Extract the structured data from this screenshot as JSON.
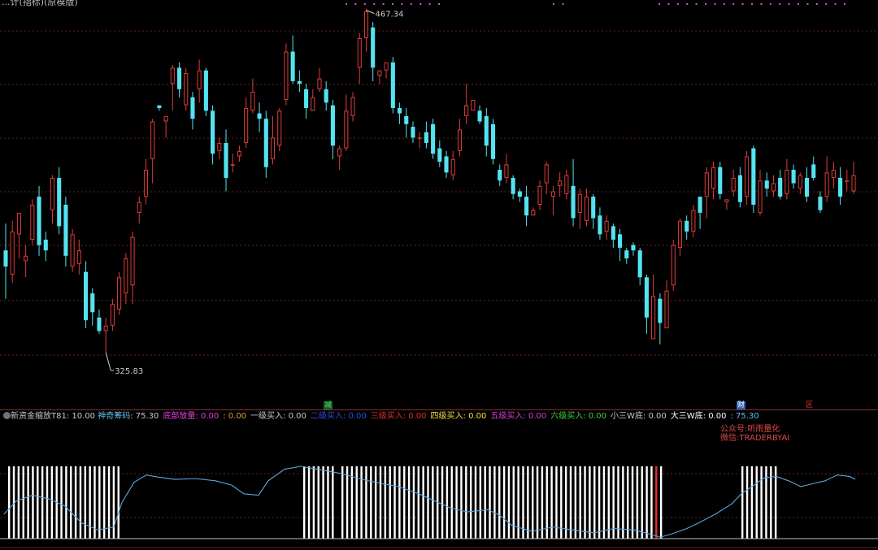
{
  "window": {
    "title": "...计(指标)(原模版)"
  },
  "theme": {
    "background": "#000000",
    "up_color": "#e03b3b",
    "down_color": "#54e3f0",
    "grid_color": "#6a1f1f",
    "panel_divider_color": "#8a2a2a",
    "magenta_dots": "#d84cd8",
    "bar_color": "#ffffff",
    "line_color": "#5aa6e0"
  },
  "main_chart": {
    "high_label": "467.34",
    "low_label": "325.83",
    "event_markers": [
      {
        "text": "减",
        "color": "#3ee05a",
        "bg": "#1d5a22",
        "name": "marker-jian"
      },
      {
        "text": "财",
        "color": "#ffffff",
        "bg": "#2c5fb0",
        "name": "marker-cai"
      },
      {
        "text": "区",
        "color": "#e24040",
        "bg": "#000000",
        "name": "marker-qu"
      }
    ]
  },
  "chart_data": {
    "type": "candlestick",
    "ylim": [
      320,
      470
    ],
    "high": 467.34,
    "low": 325.83,
    "candles": [
      [
        378,
        372,
        388,
        360
      ],
      [
        369,
        385,
        389,
        366
      ],
      [
        384,
        392,
        392,
        375
      ],
      [
        374,
        376,
        380,
        368
      ],
      [
        382,
        395,
        397,
        380
      ],
      [
        398,
        380,
        402,
        376
      ],
      [
        382,
        378,
        385,
        374
      ],
      [
        393,
        405,
        406,
        388
      ],
      [
        405,
        387,
        409,
        384
      ],
      [
        395,
        376,
        398,
        372
      ],
      [
        372,
        384,
        386,
        370
      ],
      [
        373,
        378,
        382,
        369
      ],
      [
        370,
        352,
        374,
        349
      ],
      [
        362,
        355,
        364,
        350
      ],
      [
        353,
        348,
        356,
        347
      ],
      [
        348,
        350,
        353,
        340
      ],
      [
        350,
        358,
        360,
        348
      ],
      [
        356,
        368,
        370,
        354
      ],
      [
        362,
        375,
        377,
        358
      ],
      [
        365,
        383,
        385,
        358
      ],
      [
        392,
        396,
        398,
        388
      ],
      [
        398,
        408,
        412,
        395
      ],
      [
        412,
        426,
        427,
        403
      ],
      [
        432,
        431,
        432,
        430
      ],
      [
        426,
        428,
        428,
        420
      ],
      [
        440,
        446,
        447,
        430
      ],
      [
        446,
        438,
        448,
        435
      ],
      [
        432,
        444,
        446,
        430
      ],
      [
        435,
        427,
        437,
        423
      ],
      [
        438,
        445,
        449,
        433
      ],
      [
        445,
        430,
        446,
        428
      ],
      [
        430,
        414,
        432,
        410
      ],
      [
        415,
        418,
        420,
        412
      ],
      [
        418,
        405,
        423,
        400
      ],
      [
        410,
        410,
        414,
        407
      ],
      [
        413,
        415,
        417,
        411
      ],
      [
        418,
        431,
        435,
        416
      ],
      [
        430,
        437,
        442,
        429
      ],
      [
        429,
        427,
        433,
        422
      ],
      [
        427,
        409,
        430,
        405
      ],
      [
        412,
        420,
        428,
        410
      ],
      [
        417,
        430,
        431,
        415
      ],
      [
        434,
        452,
        455,
        432
      ],
      [
        452,
        441,
        458,
        440
      ],
      [
        441,
        440,
        445,
        437
      ],
      [
        438,
        431,
        440,
        427
      ],
      [
        430,
        435,
        438,
        430
      ],
      [
        438,
        442,
        446,
        437
      ],
      [
        438,
        433,
        441,
        430
      ],
      [
        432,
        417,
        434,
        412
      ],
      [
        413,
        416,
        417,
        408
      ],
      [
        416,
        430,
        436,
        415
      ],
      [
        428,
        435,
        437,
        426
      ],
      [
        446,
        457,
        459,
        440
      ],
      [
        457,
        467,
        468,
        452
      ],
      [
        461,
        446,
        463,
        441
      ],
      [
        443,
        445,
        445,
        440
      ],
      [
        445,
        448,
        448,
        442
      ],
      [
        448,
        431,
        450,
        429
      ],
      [
        431,
        429,
        433,
        425
      ],
      [
        428,
        425,
        431,
        420
      ],
      [
        424,
        420,
        426,
        418
      ],
      [
        420,
        420,
        422,
        416
      ],
      [
        422,
        418,
        426,
        416
      ],
      [
        425,
        414,
        427,
        412
      ],
      [
        416,
        411,
        419,
        409
      ],
      [
        413,
        407,
        415,
        405
      ],
      [
        406,
        412,
        415,
        404
      ],
      [
        415,
        423,
        427,
        413
      ],
      [
        428,
        432,
        440,
        425
      ],
      [
        430,
        434,
        434,
        430
      ],
      [
        430,
        426,
        432,
        425
      ],
      [
        428,
        417,
        431,
        413
      ],
      [
        425,
        412,
        427,
        410
      ],
      [
        408,
        404,
        410,
        402
      ],
      [
        405,
        410,
        414,
        403
      ],
      [
        405,
        399,
        406,
        397
      ],
      [
        400,
        398,
        401,
        396
      ],
      [
        398,
        391,
        402,
        387
      ],
      [
        391,
        393,
        394,
        391
      ],
      [
        395,
        402,
        404,
        393
      ],
      [
        403,
        410,
        411,
        399
      ],
      [
        398,
        400,
        402,
        391
      ],
      [
        402,
        404,
        407,
        398
      ],
      [
        399,
        406,
        408,
        397
      ],
      [
        402,
        390,
        412,
        387
      ],
      [
        392,
        399,
        401,
        386
      ],
      [
        389,
        398,
        401,
        387
      ],
      [
        398,
        390,
        399,
        386
      ],
      [
        391,
        384,
        394,
        382
      ],
      [
        385,
        389,
        391,
        382
      ],
      [
        387,
        382,
        388,
        379
      ],
      [
        384,
        379,
        386,
        374
      ],
      [
        378,
        375,
        379,
        373
      ],
      [
        380,
        378,
        381,
        376
      ],
      [
        378,
        368,
        379,
        365
      ],
      [
        368,
        353,
        369,
        347
      ],
      [
        345,
        361,
        369,
        345
      ],
      [
        360,
        351,
        362,
        343
      ],
      [
        349,
        363,
        367,
        349
      ],
      [
        365,
        380,
        382,
        363
      ],
      [
        379,
        389,
        390,
        376
      ],
      [
        389,
        385,
        391,
        382
      ],
      [
        385,
        393,
        395,
        383
      ],
      [
        398,
        392,
        398,
        386
      ],
      [
        398,
        407,
        409,
        390
      ],
      [
        401,
        409,
        411,
        397
      ],
      [
        409,
        399,
        411,
        397
      ],
      [
        396,
        397,
        397,
        393
      ],
      [
        400,
        405,
        408,
        398
      ],
      [
        406,
        396,
        409,
        394
      ],
      [
        398,
        413,
        415,
        395
      ],
      [
        416,
        395,
        417,
        392
      ],
      [
        392,
        404,
        408,
        391
      ],
      [
        404,
        401,
        407,
        398
      ],
      [
        400,
        403,
        406,
        398
      ],
      [
        405,
        398,
        408,
        397
      ],
      [
        399,
        408,
        412,
        397
      ],
      [
        408,
        403,
        410,
        401
      ],
      [
        401,
        406,
        407,
        399
      ],
      [
        405,
        398,
        409,
        396
      ],
      [
        410,
        405,
        413,
        404
      ],
      [
        398,
        393,
        400,
        392
      ],
      [
        398,
        407,
        413,
        396
      ],
      [
        405,
        408,
        411,
        401
      ],
      [
        405,
        398,
        409,
        395
      ],
      [
        404,
        404,
        408,
        400
      ],
      [
        400,
        406,
        411,
        399
      ]
    ]
  },
  "indicator": {
    "name": "新资金缩放T81",
    "name_value": ": 10.00",
    "items": [
      {
        "label": "神奇筹码",
        "value": ": 75.30",
        "color": "#5fc1f0"
      },
      {
        "label": "底部放量",
        "value": ": 0.00",
        "color": "#e040e0",
        "value_color": "#e040e0"
      },
      {
        "label": "",
        "value": ": 0.00",
        "color": "#d9a040",
        "value_color": "#d9a040"
      },
      {
        "label": "一级买入",
        "value": ": 0.00",
        "color": "#c8c8c8",
        "value_color": "#c8c8c8"
      },
      {
        "label": "二级买入",
        "value": ": 0.00",
        "color": "#2f4fe0",
        "value_color": "#2f4fe0"
      },
      {
        "label": "三级买入",
        "value": ": 0.00",
        "color": "#e03030",
        "value_color": "#e03030"
      },
      {
        "label": "四级买入",
        "value": ": 0.00",
        "color": "#f0e040",
        "value_color": "#f0e040"
      },
      {
        "label": "五级买入",
        "value": ": 0.00",
        "color": "#d040d0",
        "value_color": "#d040d0"
      },
      {
        "label": "六级买入",
        "value": ": 0.00",
        "color": "#40d040",
        "value_color": "#40d040"
      },
      {
        "label": "小三W底",
        "value": ": 0.00",
        "color": "#c8c8c8",
        "value_color": "#c8c8c8"
      },
      {
        "label": "大三W底",
        "value": ": 0.00",
        "color": "#ffffff",
        "value_color": "#ffffff"
      },
      {
        "label": "",
        "value": ": 75.30",
        "color": "#5fc1f0",
        "value_color": "#5fc1f0"
      }
    ],
    "watermark": {
      "line1": "公众号:听雨量化",
      "line2": "微信:TRADERBYAI"
    },
    "ylim": [
      0,
      100
    ],
    "bars": [
      [
        10,
        145,
        "#ffffff"
      ],
      [
        373,
        412,
        "#ffffff"
      ],
      [
        420,
        817,
        "#ffffff"
      ],
      [
        912,
        958,
        "#ffffff"
      ]
    ],
    "red_bar_index": 805,
    "line": [
      [
        5,
        34
      ],
      [
        20,
        52
      ],
      [
        40,
        60
      ],
      [
        60,
        55
      ],
      [
        80,
        45
      ],
      [
        100,
        22
      ],
      [
        120,
        12
      ],
      [
        140,
        16
      ],
      [
        150,
        50
      ],
      [
        165,
        78
      ],
      [
        180,
        88
      ],
      [
        195,
        85
      ],
      [
        215,
        82
      ],
      [
        240,
        83
      ],
      [
        265,
        80
      ],
      [
        285,
        74
      ],
      [
        300,
        62
      ],
      [
        318,
        60
      ],
      [
        330,
        80
      ],
      [
        350,
        96
      ],
      [
        370,
        100
      ],
      [
        385,
        97
      ],
      [
        400,
        94
      ],
      [
        420,
        90
      ],
      [
        445,
        82
      ],
      [
        470,
        76
      ],
      [
        490,
        72
      ],
      [
        515,
        62
      ],
      [
        535,
        52
      ],
      [
        555,
        42
      ],
      [
        575,
        37
      ],
      [
        600,
        40
      ],
      [
        615,
        32
      ],
      [
        630,
        18
      ],
      [
        655,
        10
      ],
      [
        680,
        16
      ],
      [
        705,
        12
      ],
      [
        730,
        8
      ],
      [
        755,
        14
      ],
      [
        780,
        12
      ],
      [
        800,
        6
      ],
      [
        812,
        2
      ],
      [
        825,
        6
      ],
      [
        845,
        14
      ],
      [
        860,
        22
      ],
      [
        880,
        34
      ],
      [
        900,
        48
      ],
      [
        912,
        62
      ],
      [
        925,
        72
      ],
      [
        940,
        84
      ],
      [
        955,
        86
      ],
      [
        970,
        80
      ],
      [
        985,
        72
      ],
      [
        1000,
        76
      ],
      [
        1015,
        80
      ],
      [
        1030,
        88
      ],
      [
        1045,
        86
      ],
      [
        1052,
        82
      ]
    ]
  }
}
